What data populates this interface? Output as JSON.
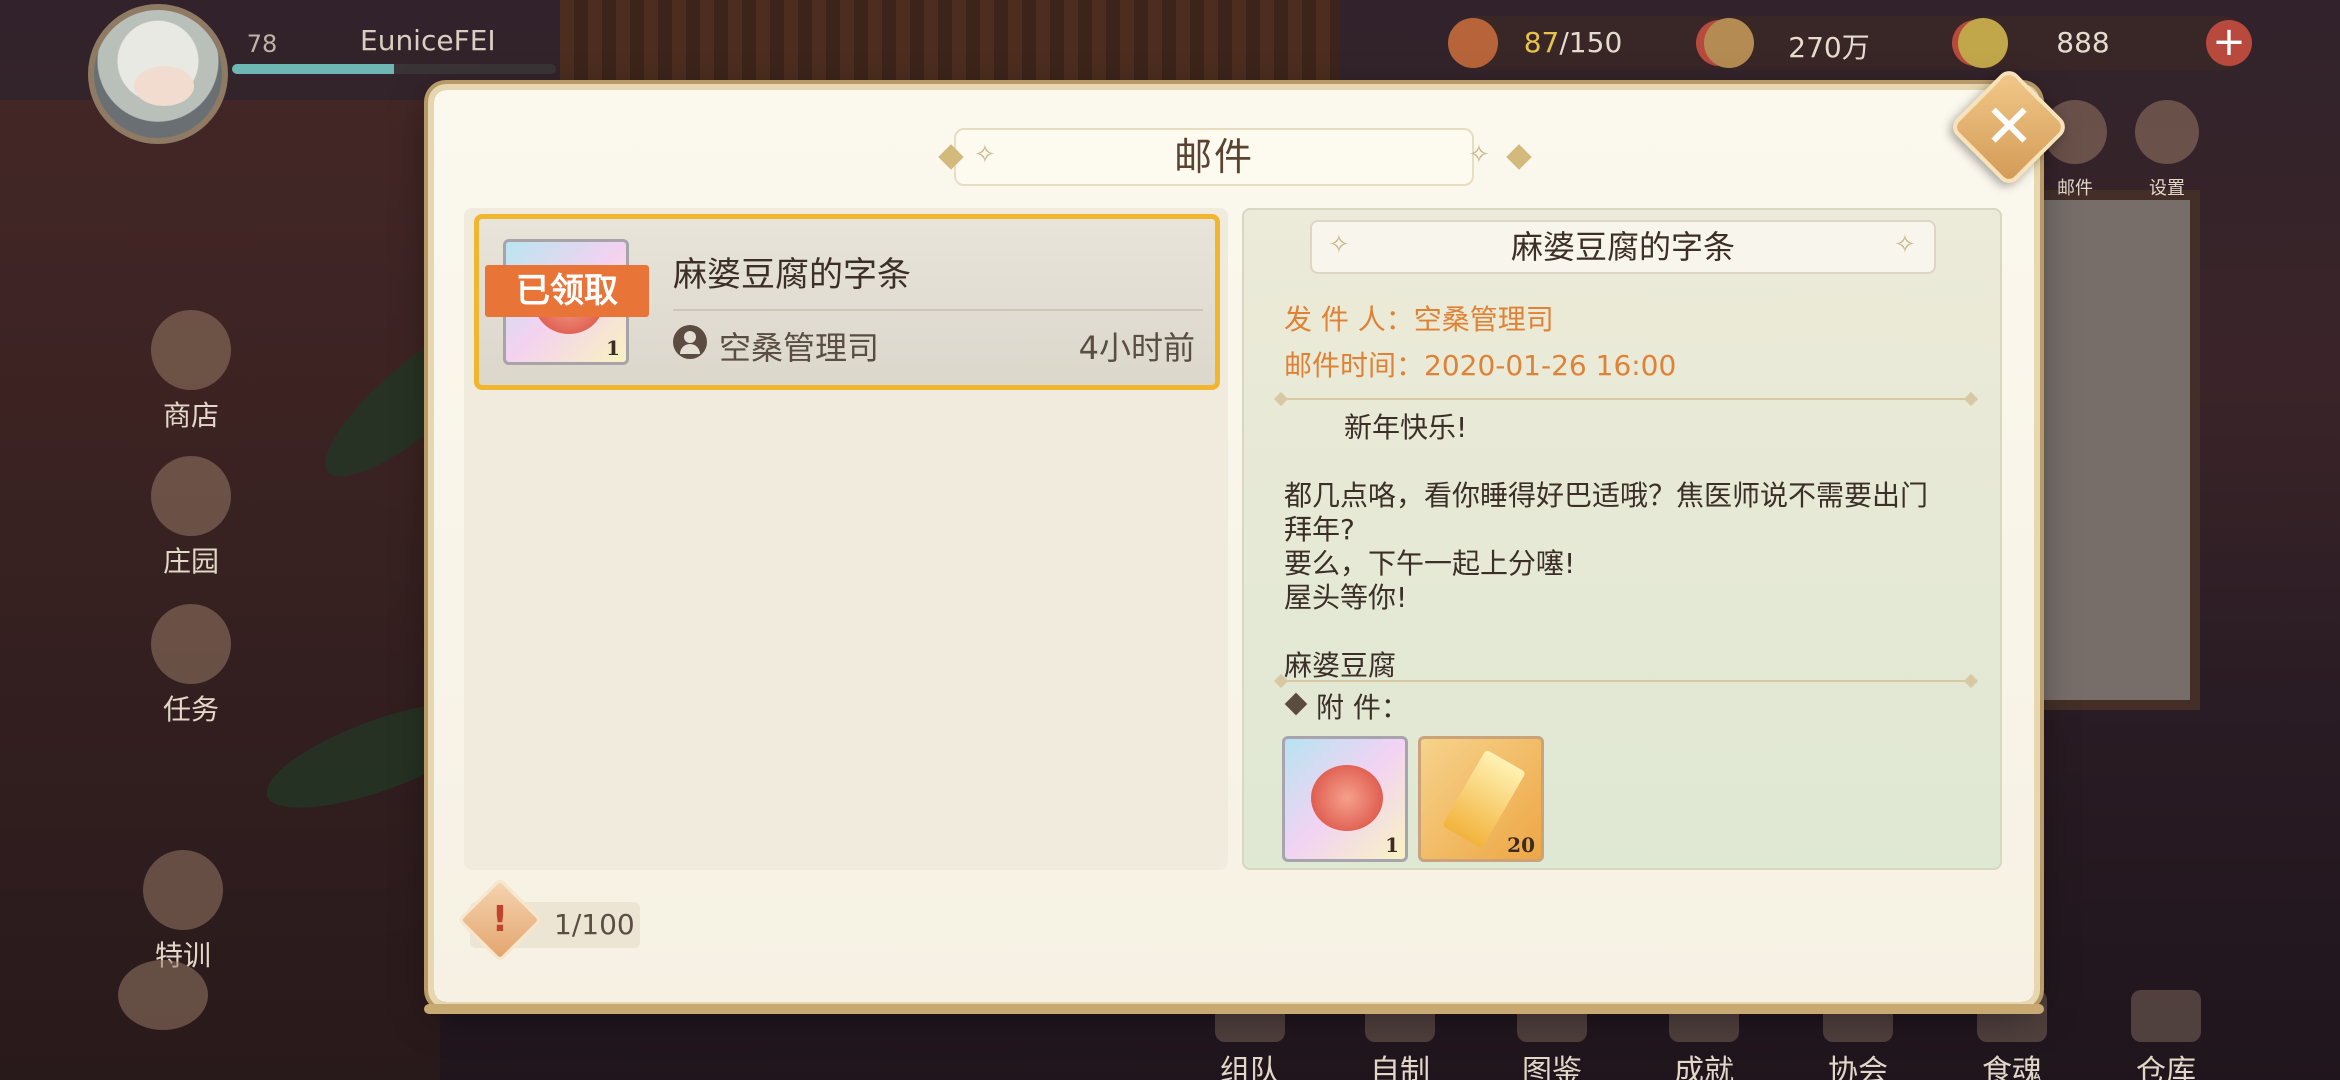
{
  "hud": {
    "level": "78",
    "player_name": "EuniceFEI",
    "exp_fraction": 0.5,
    "stamina": {
      "current": "87",
      "max": "/150"
    },
    "coins": "270万",
    "gems": "888"
  },
  "side_menu": [
    {
      "label": "商店"
    },
    {
      "label": "庄园"
    },
    {
      "label": "任务"
    },
    {
      "label": "特训"
    }
  ],
  "bottom_menu": [
    {
      "label": "组队"
    },
    {
      "label": "自制"
    },
    {
      "label": "图鉴"
    },
    {
      "label": "成就"
    },
    {
      "label": "协会"
    },
    {
      "label": "食魂"
    },
    {
      "label": "仓库"
    }
  ],
  "top_right_menu": [
    {
      "label": "邮件"
    },
    {
      "label": "设置"
    }
  ],
  "modal": {
    "title": "邮件",
    "list": [
      {
        "title": "麻婆豆腐的字条",
        "status_badge": "已领取",
        "sender": "空桑管理司",
        "time_ago": "4小时前",
        "thumb_qty": "1"
      }
    ],
    "count": "1/100",
    "detail": {
      "title": "麻婆豆腐的字条",
      "sender_line": "发 件 人：空桑管理司",
      "time_line": "邮件时间：2020-01-26  16:00",
      "body": [
        "新年快乐!",
        "都几点咯，看你睡得好巴适哦？焦医师说不需要出门",
        "拜年?",
        "要么，下午一起上分噻!",
        "屋头等你!",
        "麻婆豆腐"
      ],
      "attachments_label": "附       件：",
      "attachments": [
        {
          "icon": "pepper-charm-icon",
          "qty": "1"
        },
        {
          "icon": "crystal-icon",
          "qty": "20"
        }
      ]
    }
  },
  "colors": {
    "accent_orange": "#e08236",
    "badge_orange": "#e87437",
    "selected_border": "#f0b630"
  }
}
